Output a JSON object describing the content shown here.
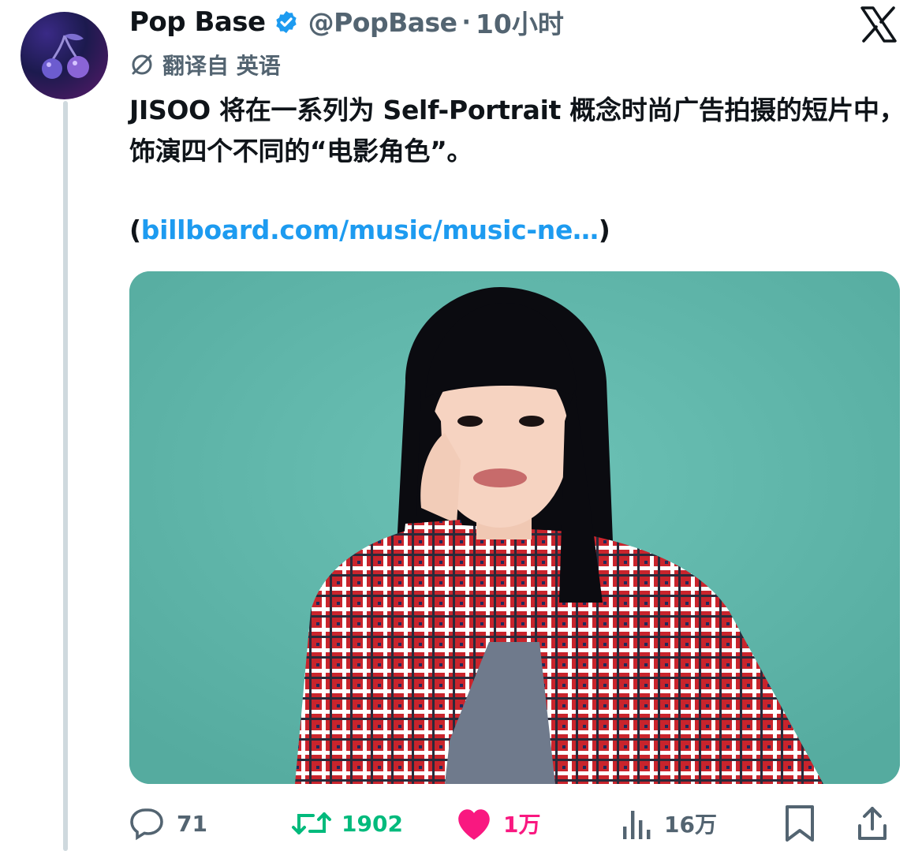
{
  "author": {
    "display_name": "Pop Base",
    "handle": "@PopBase",
    "separator": "·",
    "time": "10小时",
    "verified": true
  },
  "translation_note": "翻译自 英语",
  "tweet": {
    "text": "JISOO 将在一系列为 Self-Portrait 概念时尚广告拍摄的短片中，饰演四个不同的“电影角色”。",
    "link_open": "(",
    "link_url": "billboard.com/music/music-ne…",
    "link_close": ")"
  },
  "actions": {
    "replies": "71",
    "retweets": "1902",
    "likes": "1万",
    "views": "16万"
  },
  "icons": [
    "cherry-logo-icon",
    "verified-badge-icon",
    "x-logo-icon",
    "translate-icon",
    "reply-icon",
    "retweet-icon",
    "like-heart-icon",
    "views-icon",
    "bookmark-icon",
    "share-icon"
  ],
  "colors": {
    "link": "#1d9bf0",
    "verified": "#1d9bf0",
    "retweet": "#00ba7c",
    "like": "#f91880",
    "muted": "#536471",
    "media_background": "#5fb5a9"
  }
}
